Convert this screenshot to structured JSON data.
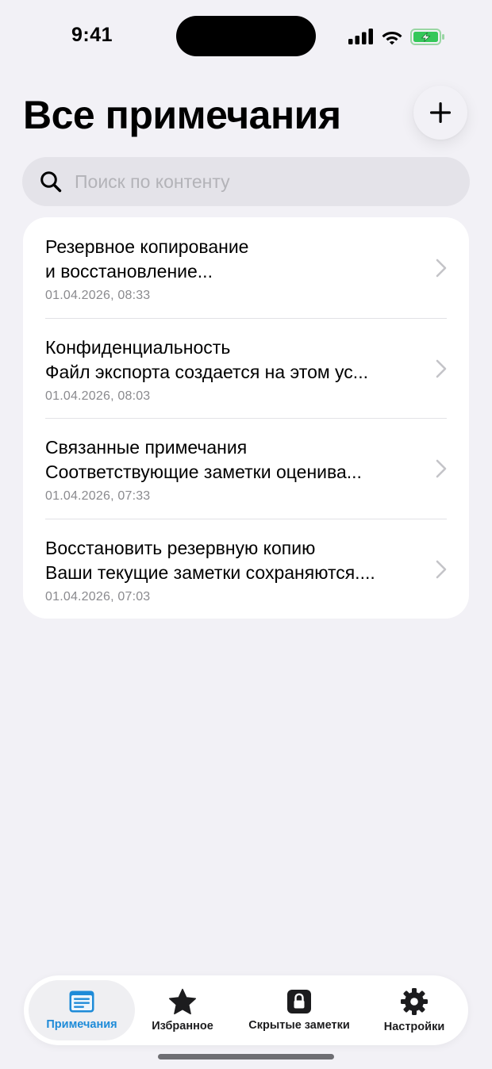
{
  "status_bar": {
    "time": "9:41",
    "battery_color": "#34C759"
  },
  "header": {
    "title": "Все примечания",
    "add_icon": "plus-icon"
  },
  "search": {
    "placeholder": "Поиск по контенту",
    "value": "",
    "icon": "search-icon"
  },
  "notes": [
    {
      "title": "Резервное копирование",
      "preview": "и восстановление...",
      "date": "01.04.2026, 08:33"
    },
    {
      "title": "Конфиденциальность",
      "preview": "Файл экспорта создается на этом ус...",
      "date": "01.04.2026, 08:03"
    },
    {
      "title": "Связанные примечания",
      "preview": "Соответствующие заметки оценива...",
      "date": "01.04.2026, 07:33"
    },
    {
      "title": "Восстановить резервную копию",
      "preview": "Ваши текущие заметки сохраняются....",
      "date": "01.04.2026, 07:03"
    }
  ],
  "tabs": [
    {
      "label": "Примечания",
      "icon": "notes-icon",
      "active": true
    },
    {
      "label": "Избранное",
      "icon": "star-icon",
      "active": false
    },
    {
      "label": "Скрытые заметки",
      "icon": "lock-icon",
      "active": false
    },
    {
      "label": "Настройки",
      "icon": "gear-icon",
      "active": false
    }
  ],
  "colors": {
    "accent": "#1E8BD8",
    "background": "#F2F1F6",
    "secondary_text": "#8A8A8E"
  }
}
